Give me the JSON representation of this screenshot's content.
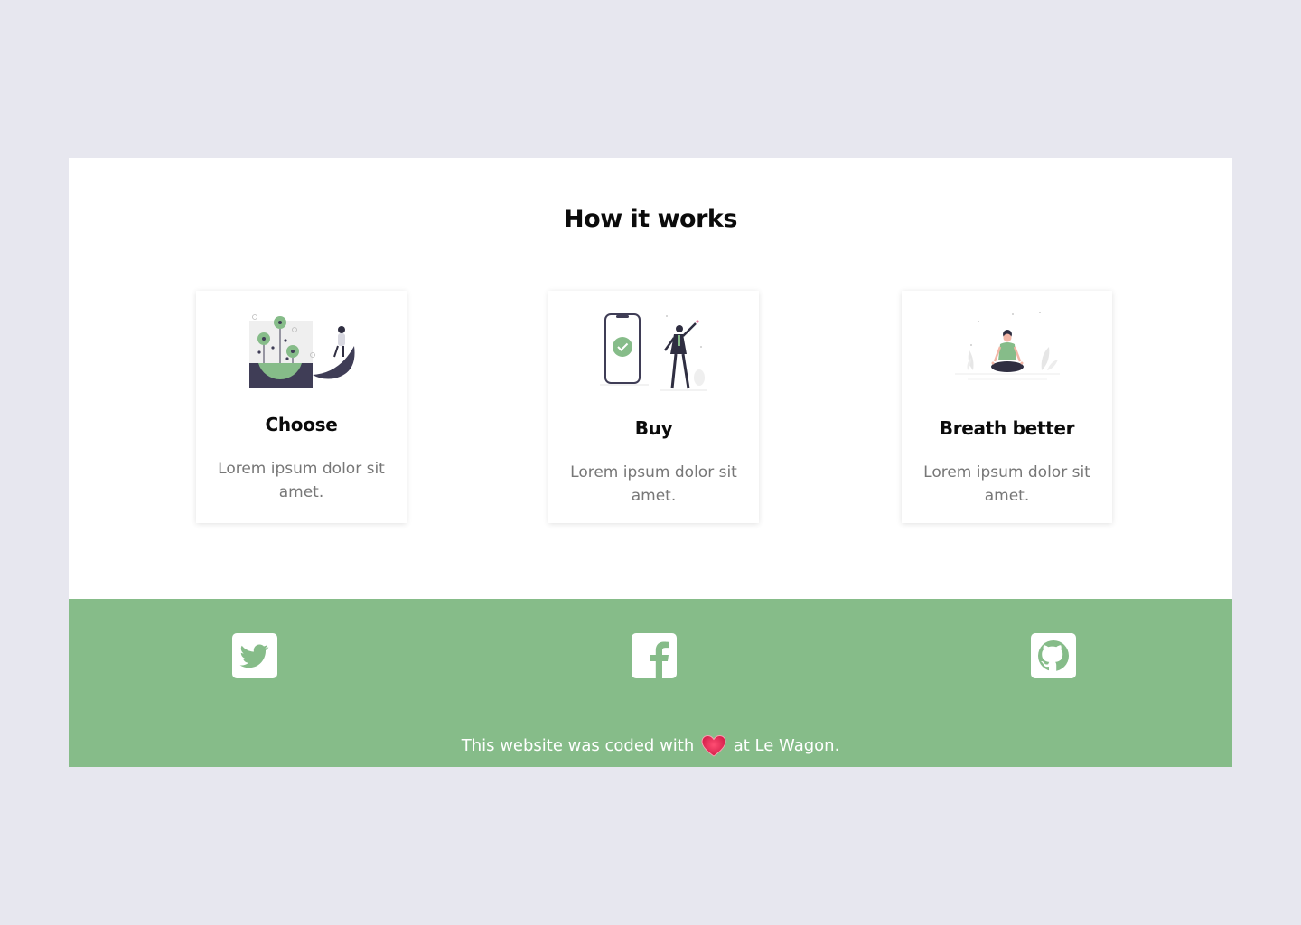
{
  "section": {
    "title": "How it works"
  },
  "cards": [
    {
      "icon": "plant-garden-illustration",
      "title": "Choose",
      "text": "Lorem ipsum dolor sit amet."
    },
    {
      "icon": "phone-checkout-illustration",
      "title": "Buy",
      "text": "Lorem ipsum dolor sit amet."
    },
    {
      "icon": "meditation-illustration",
      "title": "Breath better",
      "text": "Lorem ipsum dolor sit amet."
    }
  ],
  "footer": {
    "social": [
      {
        "name": "twitter-icon"
      },
      {
        "name": "facebook-icon"
      },
      {
        "name": "github-icon"
      }
    ],
    "text_before": "This website was coded with",
    "text_after": "at Le Wagon."
  },
  "colors": {
    "page_background": "#e7e7ef",
    "accent_green": "#86bc89",
    "heart": "#e0305a"
  }
}
